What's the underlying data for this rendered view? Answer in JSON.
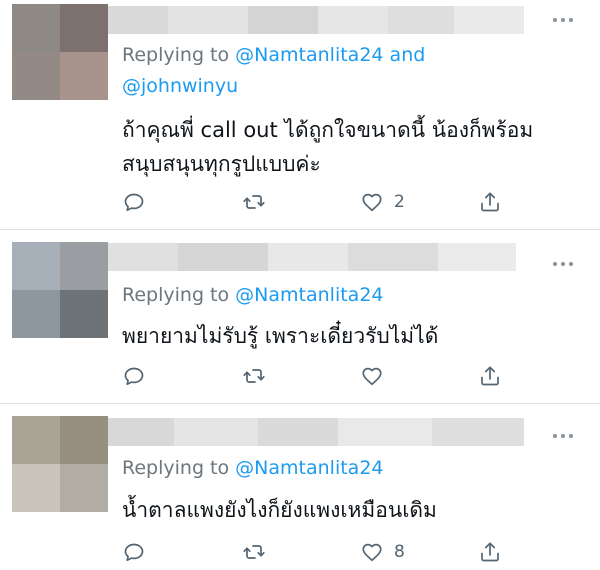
{
  "tweets": [
    {
      "reply_prefix": "Replying to",
      "mention_1": "@Namtanlita24",
      "reply_join": "and",
      "mention_2": "@johnwinyu",
      "text_line1": "ถ้าคุณพี่ call out ได้ถูกใจขนาดนี้ น้องก็พร้อม",
      "text_line2": "สนุบสนุนทุกรูปแบบค่ะ",
      "like_count": "2",
      "icons": [
        "reply-icon",
        "retweet-icon",
        "like-icon",
        "share-icon",
        "more-icon"
      ],
      "avatar_colors": [
        "#8f8986",
        "#7c716e",
        "#938a86",
        "#a8948d"
      ]
    },
    {
      "reply_prefix": "Replying to",
      "mention_1": "@Namtanlita24",
      "text_line1": "พยายามไม่รับรู้ เพราะเดี๋ยวรับไม่ได้",
      "like_count": "",
      "icons": [
        "reply-icon",
        "retweet-icon",
        "like-icon",
        "share-icon",
        "more-icon"
      ],
      "avatar_colors": [
        "#a7b0b8",
        "#9a9da2",
        "#8e969e",
        "#6e7378"
      ]
    },
    {
      "reply_prefix": "Replying to",
      "mention_1": "@Namtanlita24",
      "text_line1": "น้ำตาลแพงยังไงก็ยังแพงเหมือนเดิม",
      "like_count": "8",
      "icons": [
        "reply-icon",
        "retweet-icon",
        "like-icon",
        "share-icon",
        "more-icon"
      ],
      "avatar_colors": [
        "#a9a496",
        "#968f80",
        "#c9c5bb",
        "#b1ada4"
      ]
    }
  ],
  "colors": {
    "mention": "#1d9bf0",
    "secondary_text": "#6e767d",
    "primary_text": "#0f1419",
    "divider": "#dcdfe2"
  }
}
